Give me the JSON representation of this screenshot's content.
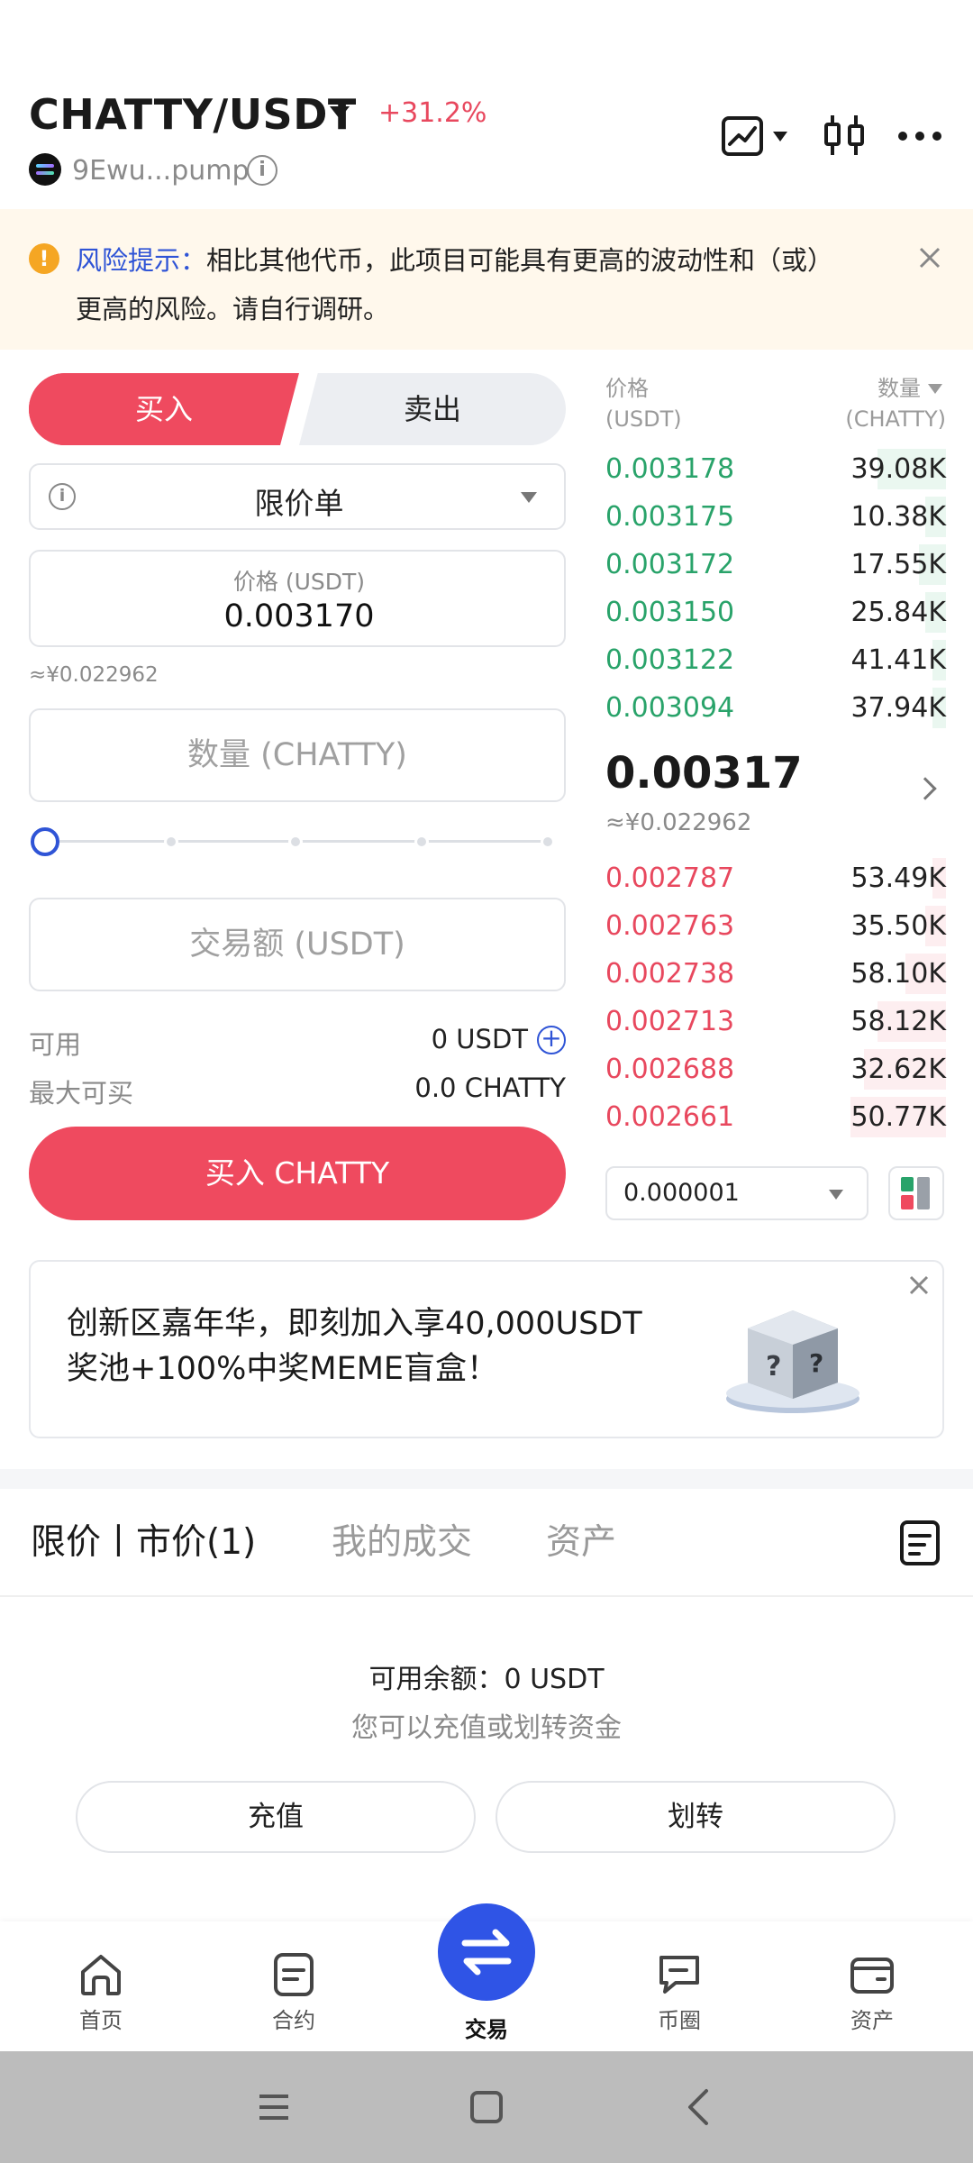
{
  "header": {
    "pair": "CHATTY/USDT",
    "change": "+31.2%",
    "contract": "9Ewu...pump"
  },
  "risk": {
    "title": "风险提示：",
    "text": "相比其他代币，此项目可能具有更高的波动性和（或）更高的风险。请自行调研。"
  },
  "trade": {
    "buy_tab": "买入",
    "sell_tab": "卖出",
    "order_type": "限价单",
    "price_label": "价格 (USDT)",
    "price_value": "0.003170",
    "price_cny": "≈¥0.022962",
    "qty_placeholder": "数量 (CHATTY)",
    "amount_placeholder": "交易额 (USDT)",
    "available_label": "可用",
    "available_value": "0 USDT",
    "max_label": "最大可买",
    "max_value": "0.0 CHATTY",
    "buy_button": "买入 CHATTY",
    "slider_percent": 0
  },
  "orderbook": {
    "price_header": "价格\n(USDT)",
    "qty_header": "数量\n(CHATTY)",
    "asks": [
      {
        "price": "0.003178",
        "qty": "39.08K",
        "depth": 0.2
      },
      {
        "price": "0.003175",
        "qty": "10.38K",
        "depth": 0.06
      },
      {
        "price": "0.003172",
        "qty": "17.55K",
        "depth": 0.08
      },
      {
        "price": "0.003150",
        "qty": "25.84K",
        "depth": 0.06
      },
      {
        "price": "0.003122",
        "qty": "41.41K",
        "depth": 0.04
      },
      {
        "price": "0.003094",
        "qty": "37.94K",
        "depth": 0.04
      }
    ],
    "mid_price": "0.00317",
    "mid_cny": "≈¥0.022962",
    "bids": [
      {
        "price": "0.002787",
        "qty": "53.49K",
        "depth": 0.04
      },
      {
        "price": "0.002763",
        "qty": "35.50K",
        "depth": 0.06
      },
      {
        "price": "0.002738",
        "qty": "58.10K",
        "depth": 0.12
      },
      {
        "price": "0.002713",
        "qty": "58.12K",
        "depth": 0.2
      },
      {
        "price": "0.002688",
        "qty": "32.62K",
        "depth": 0.24
      },
      {
        "price": "0.002661",
        "qty": "50.77K",
        "depth": 0.28
      }
    ],
    "precision": "0.000001"
  },
  "promo": {
    "line1": "创新区嘉年华，即刻加入享40,000USDT",
    "line2": "奖池+100%中奖MEME盲盒！"
  },
  "orders": {
    "tab1": "限价丨市价(1)",
    "tab2": "我的成交",
    "tab3": "资产",
    "balance": "可用余额：0 USDT",
    "hint": "您可以充值或划转资金",
    "deposit": "充值",
    "transfer": "划转"
  },
  "nav": {
    "home": "首页",
    "contract": "合约",
    "trade": "交易",
    "square": "币圈",
    "assets": "资产"
  },
  "colors": {
    "buy": "#ef4a5f",
    "ask": "#29a36a",
    "accent": "#2f54d6"
  }
}
